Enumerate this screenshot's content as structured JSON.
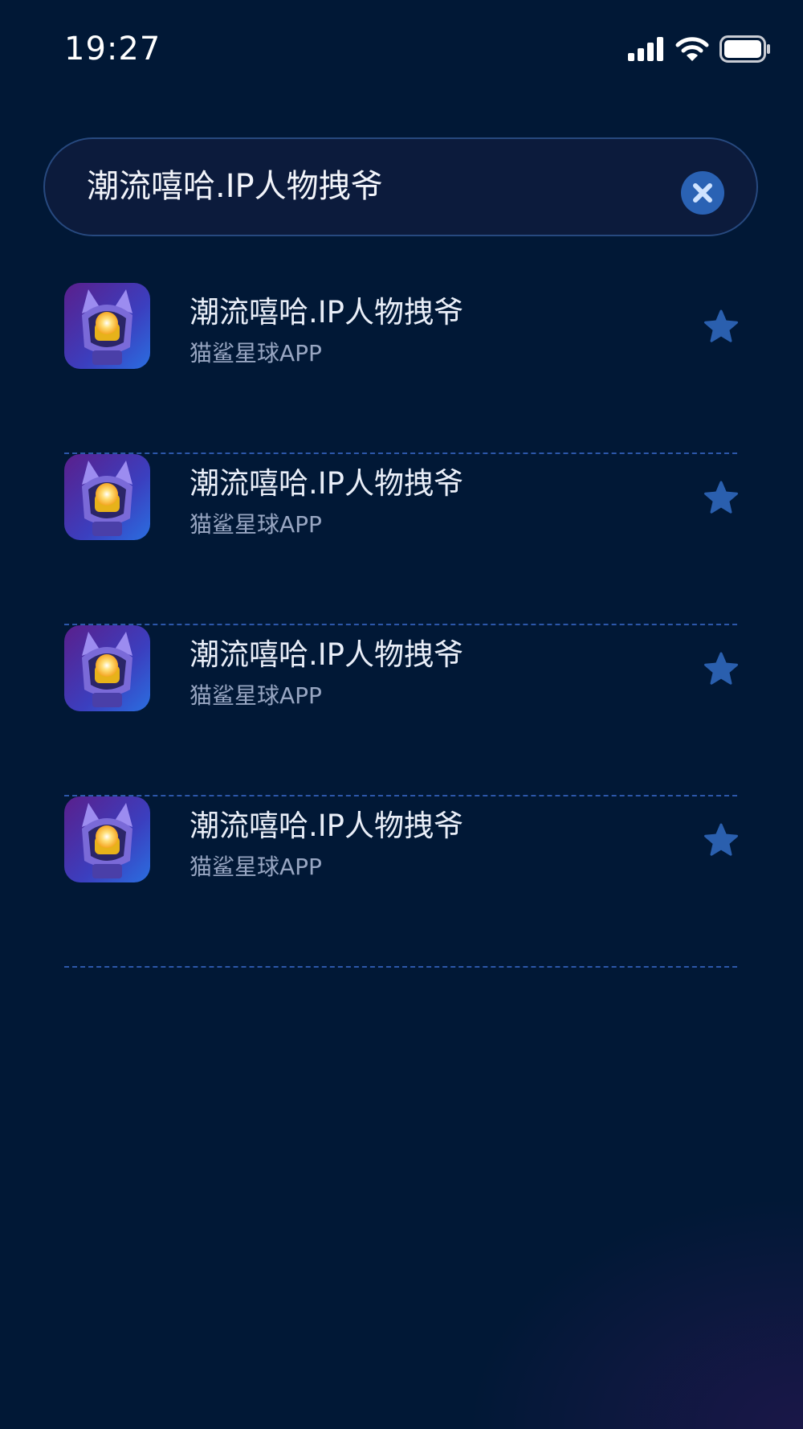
{
  "status_bar": {
    "time": "19:27",
    "icons": [
      "signal-icon",
      "wifi-icon",
      "battery-icon"
    ]
  },
  "search": {
    "value": "潮流嘻哈.IP人物拽爷",
    "clear_icon": "close-circle-icon"
  },
  "results": [
    {
      "title": "潮流嘻哈.IP人物拽爷",
      "subtitle": "猫鲨星球APP",
      "favorite_icon": "star-icon"
    },
    {
      "title": "潮流嘻哈.IP人物拽爷",
      "subtitle": "猫鲨星球APP",
      "favorite_icon": "star-icon"
    },
    {
      "title": "潮流嘻哈.IP人物拽爷",
      "subtitle": "猫鲨星球APP",
      "favorite_icon": "star-icon"
    },
    {
      "title": "潮流嘻哈.IP人物拽爷",
      "subtitle": "猫鲨星球APP",
      "favorite_icon": "star-icon"
    }
  ],
  "colors": {
    "background": "#011836",
    "accent": "#2a62b4",
    "divider": "#2c57aa",
    "star": "#2a5fae"
  }
}
